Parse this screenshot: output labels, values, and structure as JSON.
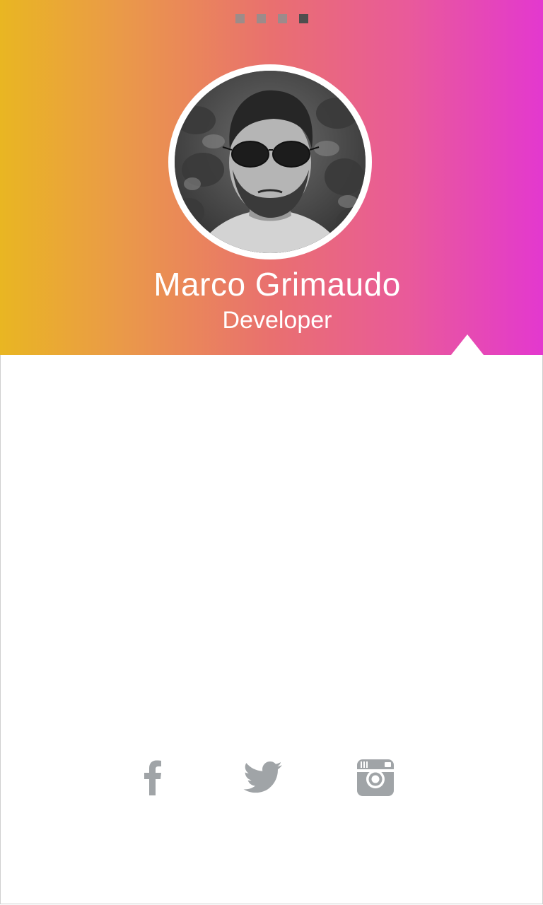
{
  "profile": {
    "name": "Marco Grimaudo",
    "role": "Developer"
  },
  "pager": {
    "count": 4,
    "active_index": 3
  },
  "social": {
    "items": [
      {
        "name": "facebook",
        "icon": "facebook-icon"
      },
      {
        "name": "twitter",
        "icon": "twitter-icon"
      },
      {
        "name": "instagram",
        "icon": "instagram-icon"
      }
    ]
  },
  "colors": {
    "gradient_start": "#e9b622",
    "gradient_mid": "#e9706f",
    "gradient_end": "#e338cf",
    "icon_gray": "#a0a4a7",
    "pager_dot": "#8f8f8f",
    "pager_dot_active": "#4e4e4e"
  }
}
